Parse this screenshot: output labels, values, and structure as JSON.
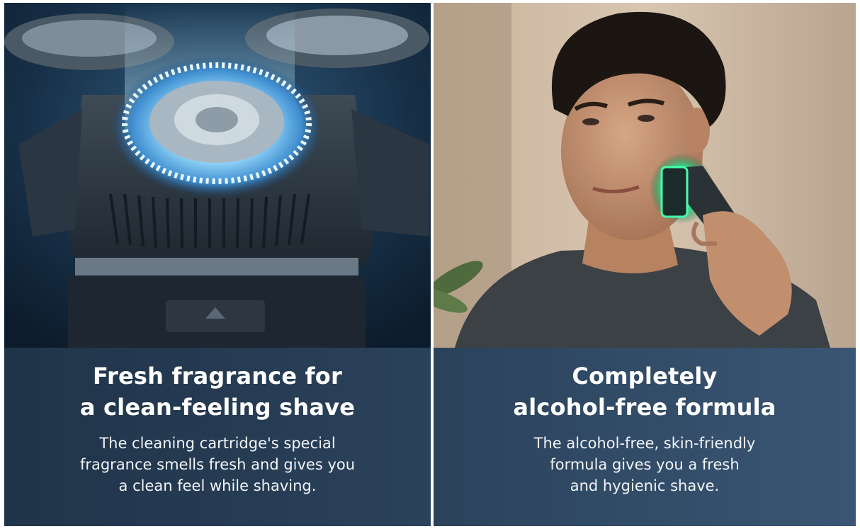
{
  "panels": [
    {
      "headline": "Fresh fragrance for\na clean-feeling shave",
      "body": "The cleaning cartridge's special\nfragrance smells fresh and gives you\na clean feel while shaving."
    },
    {
      "headline": "Completely\nalcohol-free formula",
      "body": "The alcohol-free, skin-friendly\nformula gives you a fresh\nand hygienic shave."
    }
  ],
  "colors": {
    "caption_background": "#273d55",
    "text": "#ffffff",
    "glow_blue": "#7fd6ff",
    "glow_green": "#3dffa8"
  }
}
